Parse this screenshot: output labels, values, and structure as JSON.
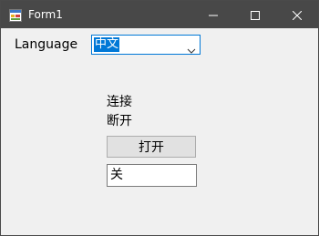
{
  "window": {
    "title": "Form1",
    "icons": {
      "app": "form-app-icon",
      "minimize": "minimize-icon",
      "maximize": "maximize-icon",
      "close": "close-icon"
    },
    "colors": {
      "titlebar": "#484848",
      "client": "#f0f0f0",
      "accent": "#0078d7"
    }
  },
  "form": {
    "language_label": "Language",
    "language_select": {
      "selected": "中文"
    },
    "connect_label": "连接",
    "disconnect_label": "断开",
    "open_button": "打开",
    "status_field_value": "关"
  }
}
